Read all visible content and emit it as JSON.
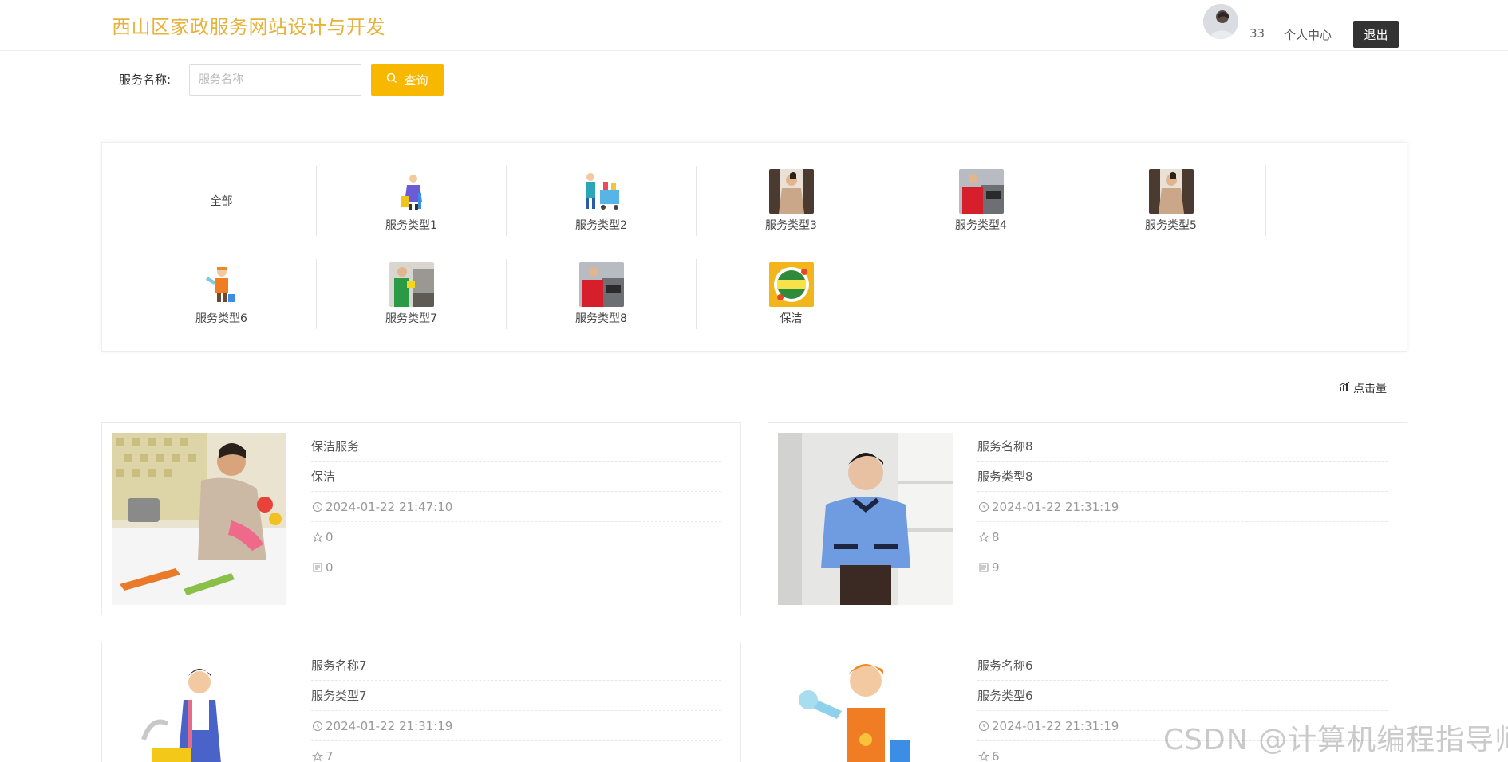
{
  "header": {
    "title": "西山区家政服务网站设计与开发",
    "username": "33",
    "center_label": "个人中心",
    "logout_label": "退出"
  },
  "search": {
    "label": "服务名称:",
    "placeholder": "服务名称",
    "button_label": "查询"
  },
  "categories": [
    {
      "label": "全部",
      "icon": "none"
    },
    {
      "label": "服务类型1",
      "icon": "cleaner-cartoon"
    },
    {
      "label": "服务类型2",
      "icon": "cleaning-cart-cartoon"
    },
    {
      "label": "服务类型3",
      "icon": "housekeeper-photo"
    },
    {
      "label": "服务类型4",
      "icon": "cooking-photo"
    },
    {
      "label": "服务类型5",
      "icon": "housekeeper-photo"
    },
    {
      "label": "服务类型6",
      "icon": "cleaner-boy-cartoon"
    },
    {
      "label": "服务类型7",
      "icon": "kitchen-clean-photo"
    },
    {
      "label": "服务类型8",
      "icon": "cooking-photo"
    },
    {
      "label": "保洁",
      "icon": "cleaning-badge"
    }
  ],
  "sort": {
    "label": "点击量"
  },
  "services": [
    {
      "name": "保洁服务",
      "type": "保洁",
      "time": "2024-01-22 21:47:10",
      "favorites": "0",
      "views": "0"
    },
    {
      "name": "服务名称8",
      "type": "服务类型8",
      "time": "2024-01-22 21:31:19",
      "favorites": "8",
      "views": "9"
    },
    {
      "name": "服务名称7",
      "type": "服务类型7",
      "time": "2024-01-22 21:31:19",
      "favorites": "7",
      "views": ""
    },
    {
      "name": "服务名称6",
      "type": "服务类型6",
      "time": "2024-01-22 21:31:19",
      "favorites": "6",
      "views": ""
    }
  ],
  "watermark": "CSDN @计算机编程指导师",
  "colors": {
    "title": "#e7b23a",
    "search_button": "#f9b800",
    "logout_button": "#333333"
  }
}
